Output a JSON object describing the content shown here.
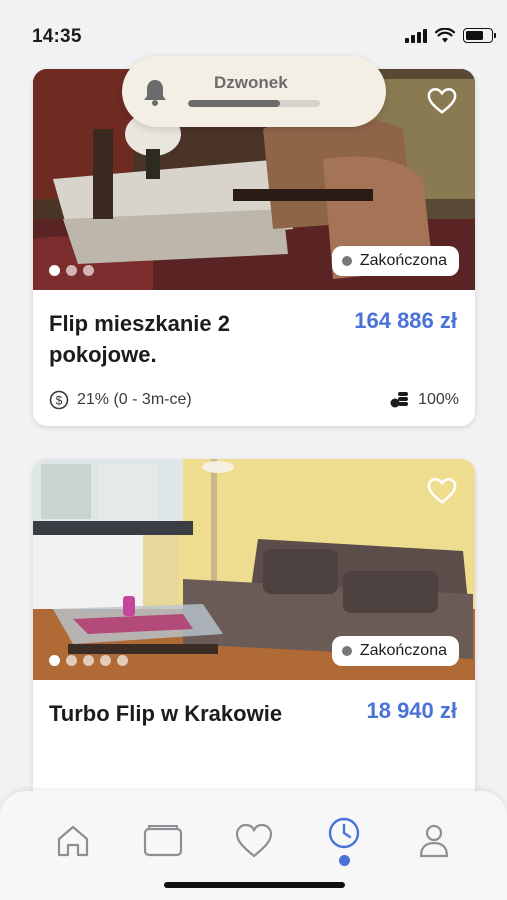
{
  "status_bar": {
    "time": "14:35"
  },
  "toast": {
    "label": "Dzwonek",
    "progress": 0.7,
    "icon": "bell-icon"
  },
  "listings": [
    {
      "title": "Flip mieszkanie 2 pokojowe.",
      "price": "164 886 zł",
      "status": "Zakończona",
      "return": "21% (0 - 3m-ce)",
      "funded": "100%",
      "photo_count": 3,
      "active_photo": 0
    },
    {
      "title": "Turbo Flip w Krakowie",
      "price": "18 940 zł",
      "status": "Zakończona",
      "photo_count": 5,
      "active_photo": 0
    }
  ],
  "tabbar": {
    "items": [
      "home-icon",
      "wallet-icon",
      "heart-icon",
      "clock-icon",
      "user-icon"
    ],
    "active": "clock-icon"
  },
  "colors": {
    "accent": "#4a72d8",
    "background": "#f2f2f4"
  }
}
